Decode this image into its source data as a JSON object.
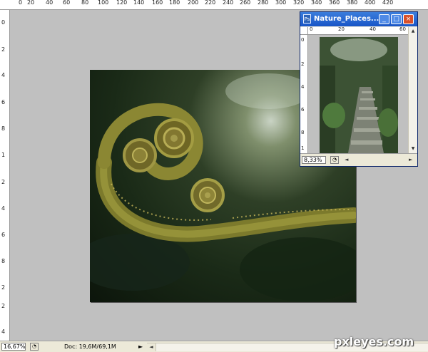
{
  "rulers": {
    "horizontal_labels": [
      "0",
      "20",
      "40",
      "60",
      "80",
      "100",
      "120",
      "140",
      "160",
      "180",
      "200",
      "220",
      "240",
      "260",
      "280",
      "300",
      "320",
      "340",
      "360",
      "380",
      "400",
      "420"
    ],
    "vertical_labels": [
      "0",
      "2",
      "4",
      "6",
      "8",
      "1",
      "2",
      "4",
      "6",
      "8",
      "2",
      "2",
      "4"
    ]
  },
  "main_window": {
    "zoom": "16,67%",
    "doc_info": "Doc: 19,6M/69,1M",
    "image": "fern-curl-in-forest"
  },
  "nav_window": {
    "title": "Nature_Places...",
    "zoom": "8,33%",
    "ruler_h_labels": [
      "0",
      "20",
      "40",
      "60"
    ],
    "ruler_v_labels": [
      "0",
      "2",
      "4",
      "6",
      "8",
      "1"
    ],
    "image": "forest-stone-steps"
  },
  "watermark": "pxleyes.com",
  "icons": {
    "status_menu": "arrow-menu-icon",
    "minimize": "minimize-icon",
    "maximize": "maximize-icon",
    "close": "close-icon"
  },
  "colors": {
    "canvas_gray": "#c0c0c0",
    "titlebar_blue": "#1855c7",
    "close_red": "#d9502a"
  }
}
